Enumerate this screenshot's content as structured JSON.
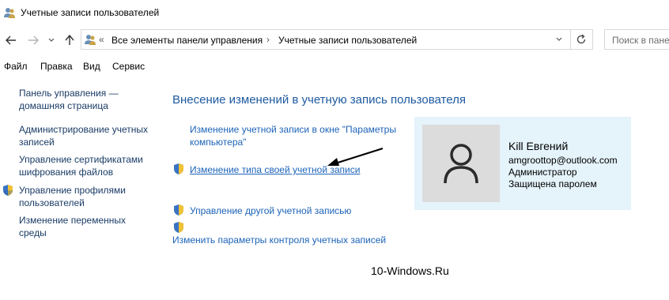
{
  "window": {
    "title": "Учетные записи пользователей"
  },
  "address": {
    "chevrons": "«",
    "crumbs": [
      "Все элементы панели управления",
      "Учетные записи пользователей"
    ],
    "separator": "›"
  },
  "search": {
    "placeholder": "Поиск в пане"
  },
  "menu": {
    "items": [
      "Файл",
      "Правка",
      "Вид",
      "Сервис"
    ]
  },
  "sidebar": {
    "links": [
      "Панель управления —\nдомашняя страница",
      "Администрирование учетных\nзаписей",
      "Управление сертификатами\nшифрования файлов",
      "Управление профилями\nпользователей",
      "Изменение переменных\nсреды"
    ]
  },
  "main": {
    "title": "Внесение изменений в учетную запись пользователя",
    "tasks": [
      "Изменение учетной записи в окне \"Параметры\nкомпьютера\"",
      "Изменение типа своей учетной записи",
      "Управление другой учетной записью",
      "Изменить параметры контроля учетных записей"
    ]
  },
  "user": {
    "name": "Kill Евгений",
    "email": "amgroottop@outlook.com",
    "role": "Администратор",
    "status": "Защищена паролем"
  },
  "watermark": "10-Windows.Ru",
  "colors": {
    "link": "#1c63b8",
    "heading": "#1e5aa0",
    "card_bg": "#e5f3fb",
    "avatar_bg": "#dcdcdc"
  }
}
